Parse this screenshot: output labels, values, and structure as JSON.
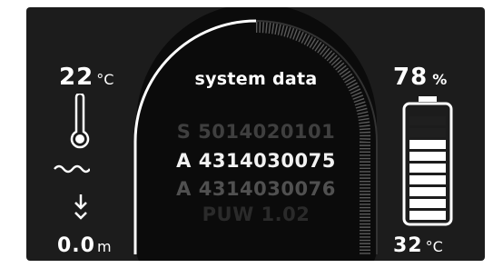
{
  "left": {
    "temperature_value": "22",
    "temperature_unit": "°C",
    "depth_value": "0.0",
    "depth_unit": "m"
  },
  "right": {
    "battery_value": "78",
    "battery_unit": "%",
    "battery_level": 0.78,
    "temperature_value": "32",
    "temperature_unit": "°C"
  },
  "center": {
    "title": "system data",
    "lines": [
      "S 5014020101",
      "A 4314030075",
      "A 4314030076",
      "PUW 1.02"
    ]
  },
  "icons": [
    "thermometer-icon",
    "water-wave-icon",
    "descend-arrow-icon",
    "battery-icon"
  ],
  "colors": {
    "background": "#1c1c1c",
    "panel": "#0b0b0b",
    "foreground": "#ffffff",
    "dim_text": "#4a4a4a"
  }
}
